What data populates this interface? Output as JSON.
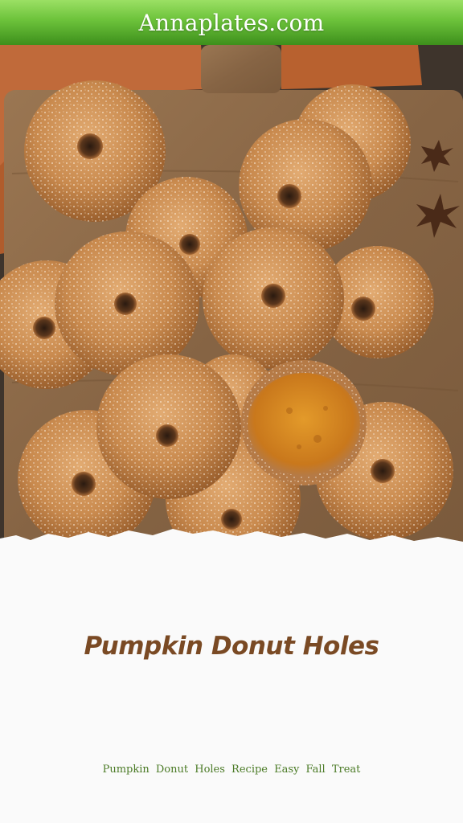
{
  "header": {
    "site_name": "Annaplates.com"
  },
  "photo": {
    "subject": "pumpkin-donuts-on-wooden-board"
  },
  "recipe": {
    "title": "Pumpkin Donut Holes",
    "tagline": "Pumpkin Donut Holes Recipe Easy Fall Treat"
  },
  "colors": {
    "header_green": "#6cc23a",
    "title_brown": "#7a4a24",
    "tagline_green": "#4a7a25",
    "donut": "#c98a4e",
    "board": "#8a6a4a",
    "napkin": "#c06a3a",
    "page_bg": "#fafafa"
  }
}
